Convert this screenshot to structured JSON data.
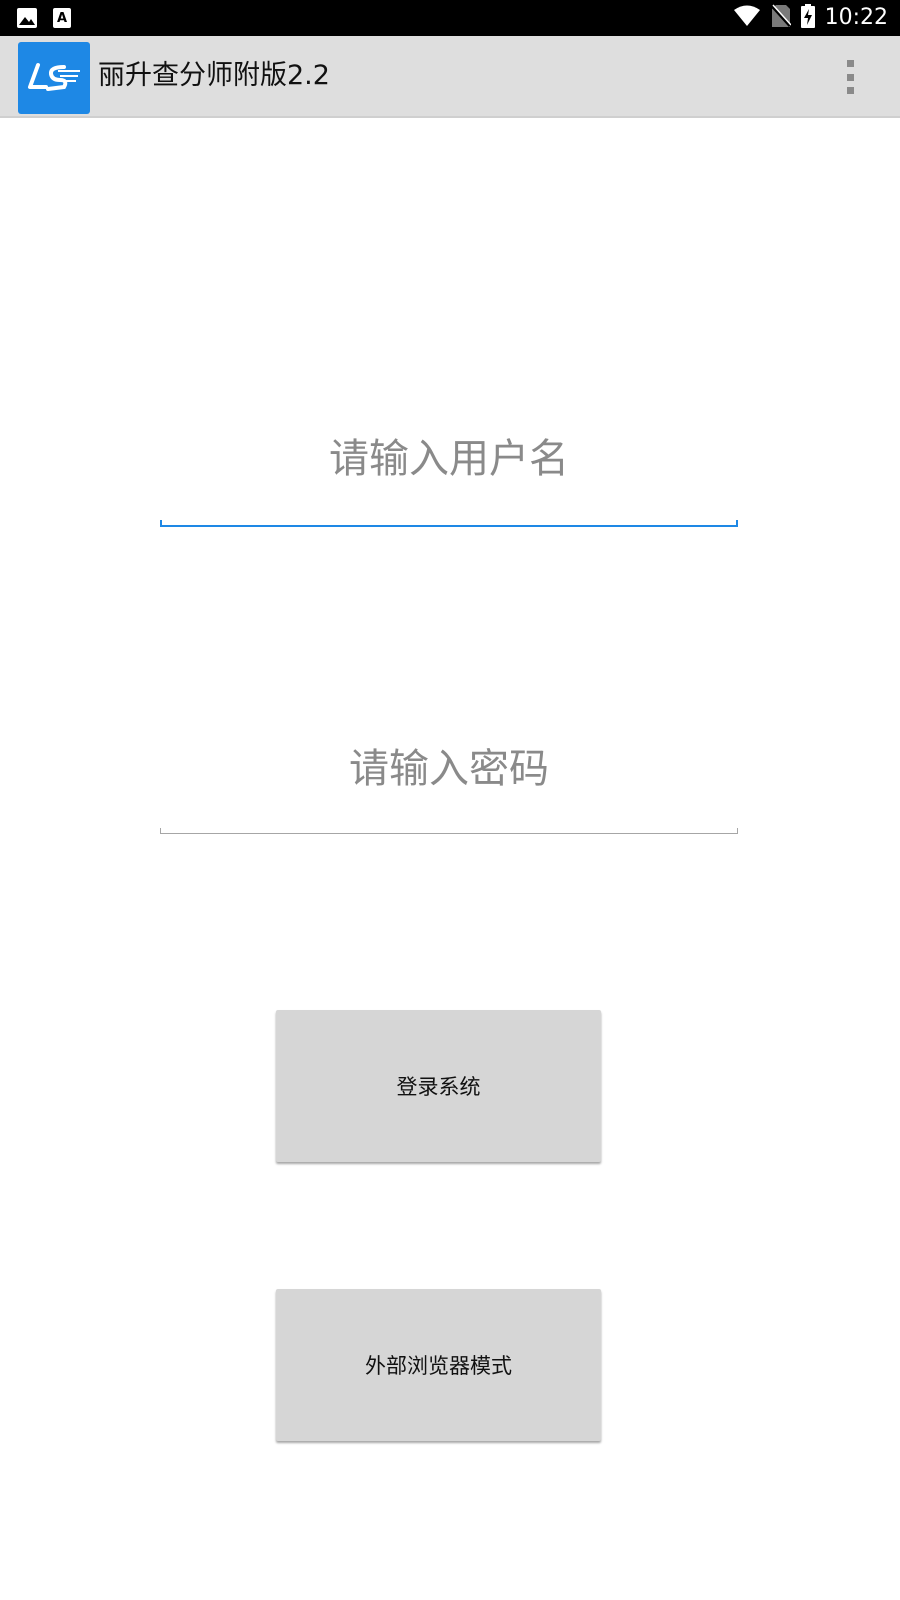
{
  "status_bar": {
    "time": "10:22",
    "left_icons": [
      "image-icon",
      "font-download-icon"
    ],
    "right_icons": [
      "wifi-icon",
      "no-sim-icon",
      "battery-charging-icon"
    ]
  },
  "app_bar": {
    "title": "丽升查分师附版2.2",
    "logo_icon": "ls-logo-icon",
    "menu_icon": "overflow-menu-icon",
    "color": "#1e88e5"
  },
  "login_form": {
    "username": {
      "placeholder": "请输入用户名",
      "value": ""
    },
    "password": {
      "placeholder": "请输入密码",
      "value": ""
    },
    "login_button_label": "登录系统",
    "external_browser_button_label": "外部浏览器模式"
  },
  "colors": {
    "accent": "#1e88e5",
    "button_bg": "#d6d6d6",
    "app_bar_bg": "#dedede",
    "status_bar_bg": "#000000"
  }
}
